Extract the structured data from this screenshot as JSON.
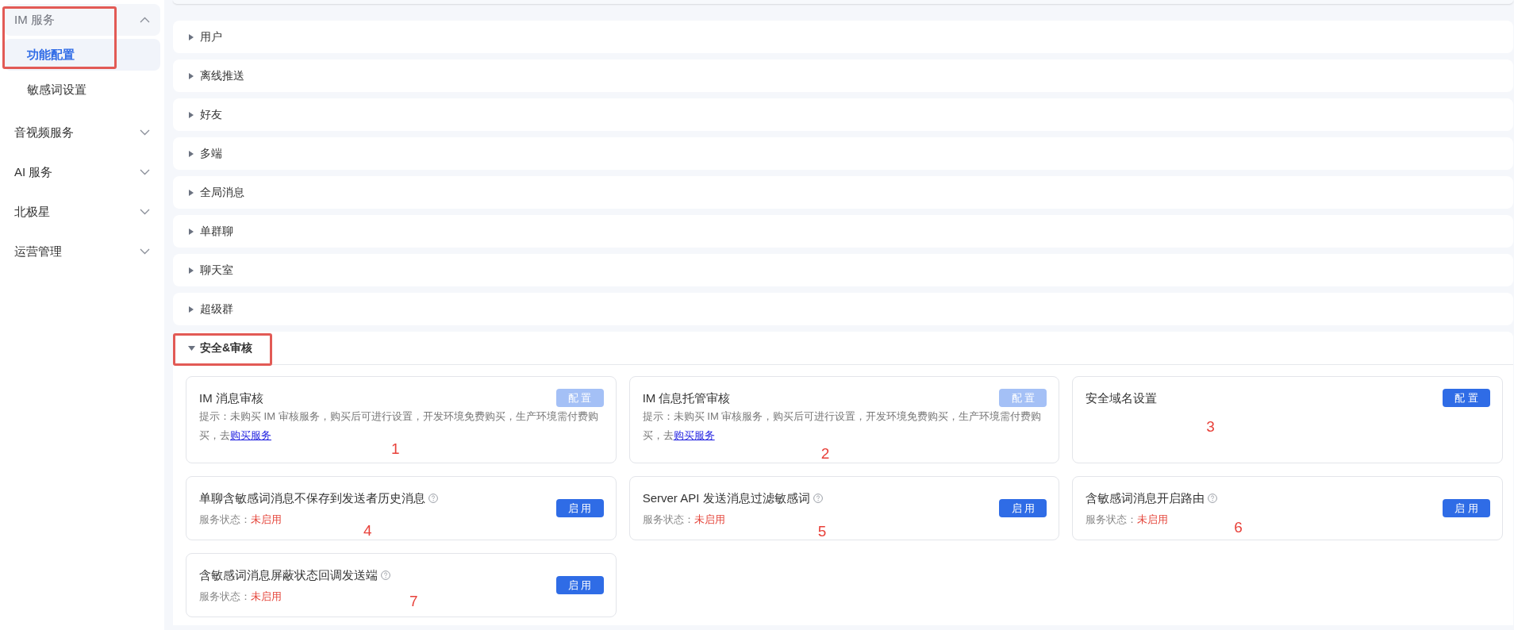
{
  "sidebar": {
    "groups": [
      {
        "label": "IM 服务",
        "expanded": true,
        "annotation_box": true,
        "children": [
          {
            "label": "功能配置",
            "selected": true
          },
          {
            "label": "敏感词设置",
            "selected": false
          }
        ]
      },
      {
        "label": "音视频服务",
        "expanded": false,
        "annotation_box": false
      },
      {
        "label": "AI 服务",
        "expanded": false,
        "annotation_box": false
      },
      {
        "label": "北极星",
        "expanded": false,
        "annotation_box": false
      },
      {
        "label": "运营管理",
        "expanded": false,
        "annotation_box": false
      }
    ]
  },
  "sections": [
    {
      "title": "用户",
      "expanded": false,
      "annotation_box": false
    },
    {
      "title": "离线推送",
      "expanded": false,
      "annotation_box": false
    },
    {
      "title": "好友",
      "expanded": false,
      "annotation_box": false
    },
    {
      "title": "多端",
      "expanded": false,
      "annotation_box": false
    },
    {
      "title": "全局消息",
      "expanded": false,
      "annotation_box": false
    },
    {
      "title": "单群聊",
      "expanded": false,
      "annotation_box": false
    },
    {
      "title": "聊天室",
      "expanded": false,
      "annotation_box": false
    },
    {
      "title": "超级群",
      "expanded": false,
      "annotation_box": false
    },
    {
      "title": "安全&审核",
      "expanded": true,
      "annotation_box": true,
      "cards": [
        {
          "kind": "config",
          "title": "IM 消息审核",
          "button": "配 置",
          "disabled": true,
          "hint": "提示：未购买 IM 审核服务，购买后可进行设置，开发环境免费购买，生产环境需付费购买，去",
          "link": "购买服务",
          "annotation": "1"
        },
        {
          "kind": "config",
          "title": "IM 信息托管审核",
          "button": "配 置",
          "disabled": true,
          "hint": "提示：未购买 IM 审核服务，购买后可进行设置，开发环境免费购买，生产环境需付费购买，去",
          "link": "购买服务",
          "annotation": "2"
        },
        {
          "kind": "config",
          "title": "安全域名设置",
          "button": "配 置",
          "disabled": false,
          "annotation": "3"
        },
        {
          "kind": "switch",
          "title": "单聊含敏感词消息不保存到发送者历史消息",
          "status_label": "服务状态：",
          "status": "未启用",
          "enabled": false,
          "button": "启 用",
          "disabled": false,
          "annotation": "4"
        },
        {
          "kind": "switch",
          "title": "Server API 发送消息过滤敏感词",
          "status_label": "服务状态：",
          "status": "未启用",
          "enabled": false,
          "button": "启 用",
          "disabled": false,
          "annotation": "5"
        },
        {
          "kind": "switch",
          "title": "含敏感词消息开启路由",
          "status_label": "服务状态：",
          "status": "未启用",
          "enabled": false,
          "button": "启 用",
          "disabled": false,
          "annotation": "6"
        },
        {
          "kind": "switch",
          "title": "含敏感词消息屏蔽状态回调发送端",
          "status_label": "服务状态：",
          "status": "未启用",
          "enabled": false,
          "button": "启 用",
          "disabled": false,
          "annotation": "7"
        }
      ]
    }
  ]
}
